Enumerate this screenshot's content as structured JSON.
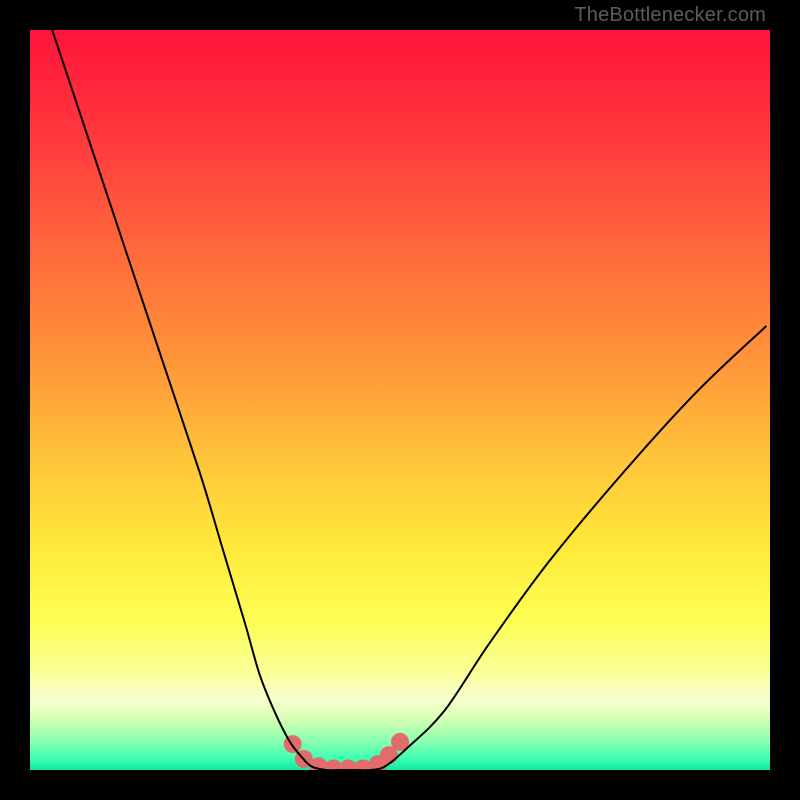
{
  "watermark": {
    "text": "TheBottlenecker.com"
  },
  "colors": {
    "bg_black": "#000000",
    "grad_top": "#ff143c",
    "grad_mid1": "#ff6a3a",
    "grad_mid2": "#ffb93a",
    "grad_mid3": "#ffe93a",
    "grad_mid4": "#faff7a",
    "grad_bottom1": "#e0ffb0",
    "grad_bottom2": "#8cffb0",
    "grad_bottom3": "#1affb0",
    "curve_stroke": "#000000",
    "marker_fill": "#e26b6b"
  },
  "chart_data": {
    "type": "line",
    "title": "",
    "xlabel": "",
    "ylabel": "",
    "xlim": [
      0,
      100
    ],
    "ylim": [
      0,
      100
    ],
    "series": [
      {
        "name": "bottleneck-curve",
        "x": [
          3,
          8,
          13,
          18,
          23,
          26,
          29,
          31,
          33,
          35,
          36.5,
          38,
          40,
          42,
          44,
          46,
          48,
          51,
          56,
          62,
          70,
          80,
          90,
          99.5
        ],
        "y": [
          100,
          85,
          70,
          55,
          40,
          30,
          20,
          13,
          8,
          4,
          2,
          0.5,
          0,
          0,
          0,
          0,
          0.5,
          3,
          8,
          17,
          28,
          40,
          51,
          60
        ]
      }
    ],
    "markers": {
      "name": "bottom-markers",
      "x": [
        35.5,
        37,
        39,
        41,
        43,
        45,
        47,
        48.5,
        50
      ],
      "y": [
        3.5,
        1.5,
        0.5,
        0.2,
        0.2,
        0.2,
        0.8,
        2,
        3.8
      ]
    }
  }
}
